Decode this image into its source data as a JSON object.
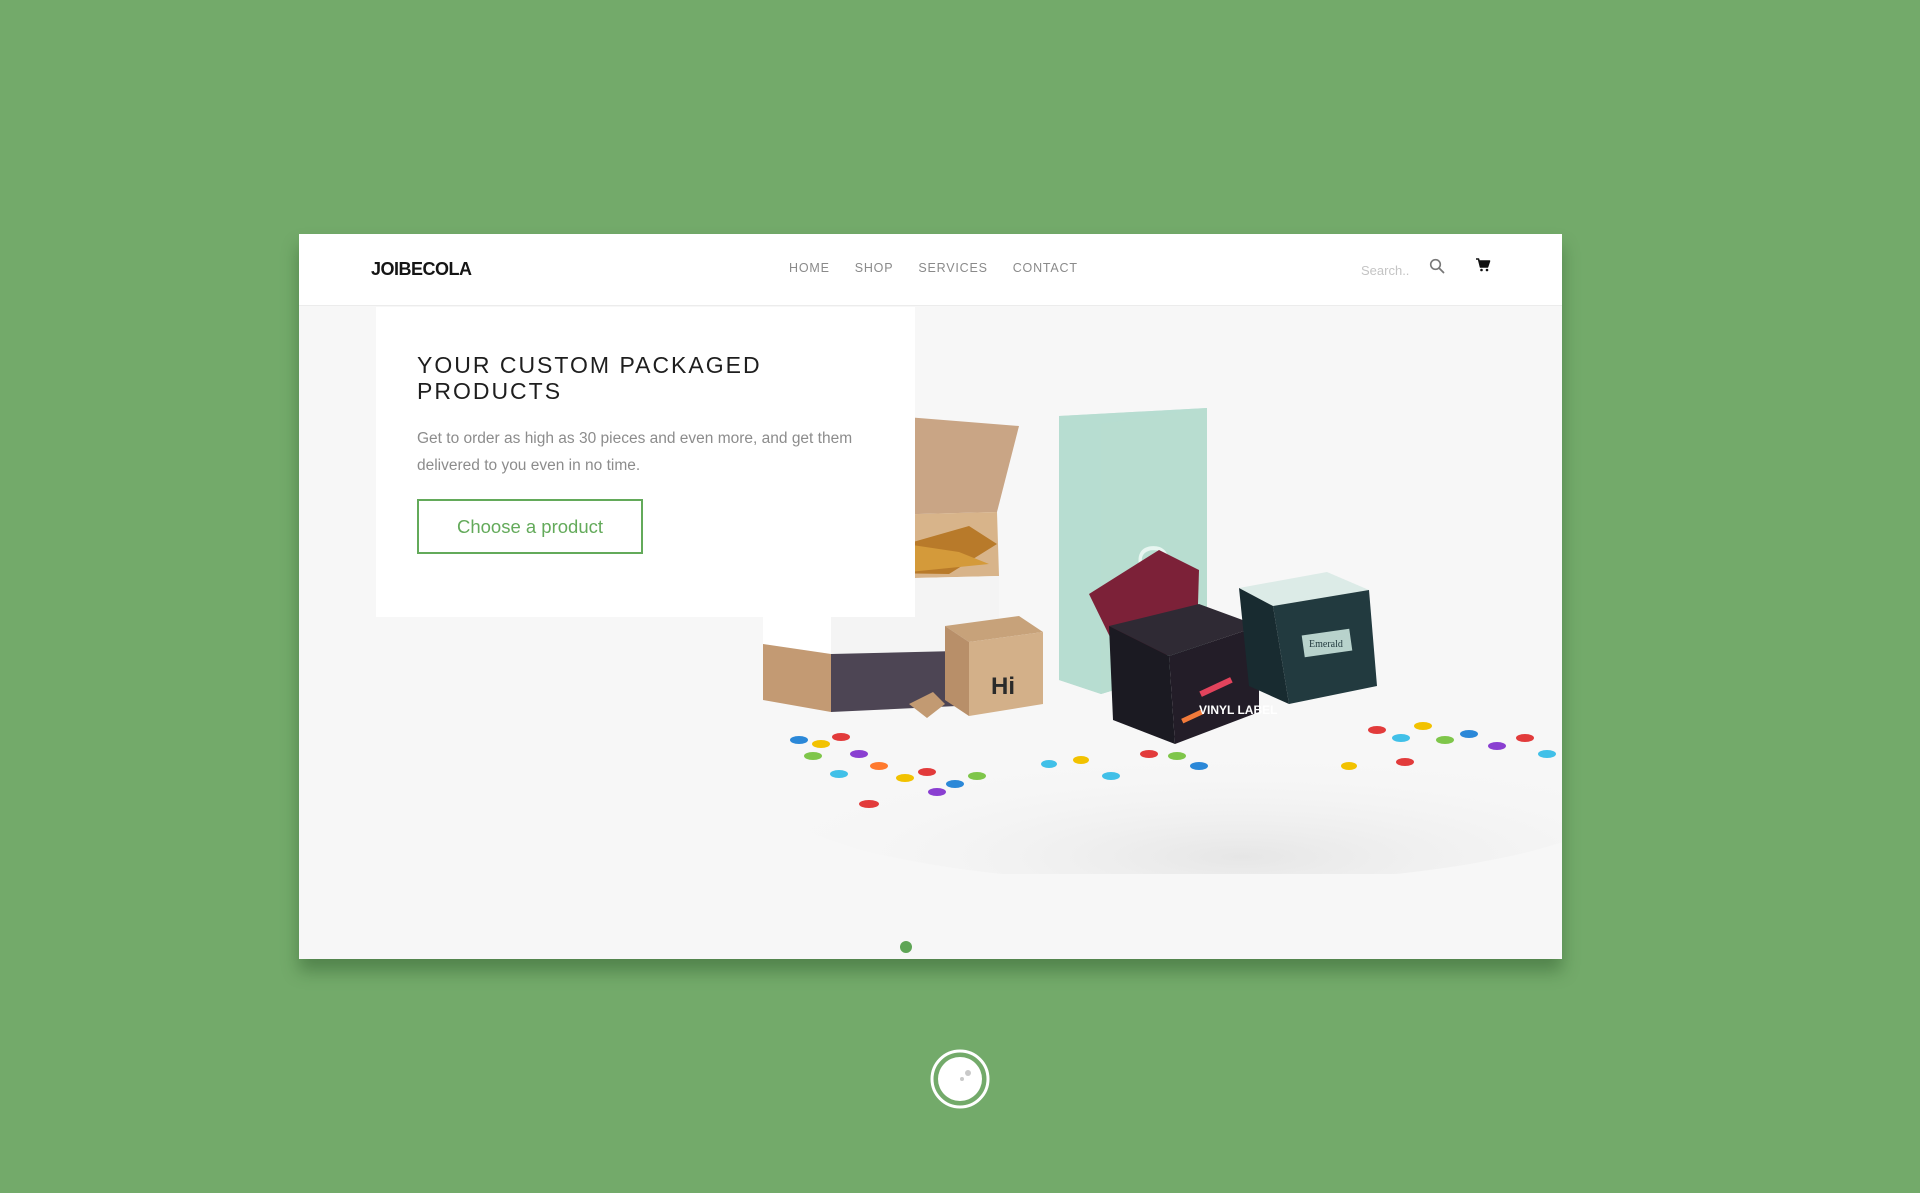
{
  "brand": {
    "name": "JOIBECOLA"
  },
  "nav": {
    "items": [
      "HOME",
      "SHOP",
      "SERVICES",
      "CONTACT"
    ]
  },
  "search": {
    "placeholder": "Search.."
  },
  "hero": {
    "title": "YOUR CUSTOM PACKAGED PRODUCTS",
    "text": "Get to order as high as 30 pieces and even more, and get them delivered to you even in no time.",
    "cta_label": "Choose a product"
  },
  "product_labels": {
    "small_box": "Hi",
    "cube": "VINYL LABEL",
    "dark_box": "Emerald"
  },
  "colors": {
    "background": "#73aa6a",
    "accent": "#63aa5a",
    "text_muted": "#8c8c8c"
  },
  "icons": [
    "search-icon",
    "cart-icon",
    "loader-icon"
  ]
}
